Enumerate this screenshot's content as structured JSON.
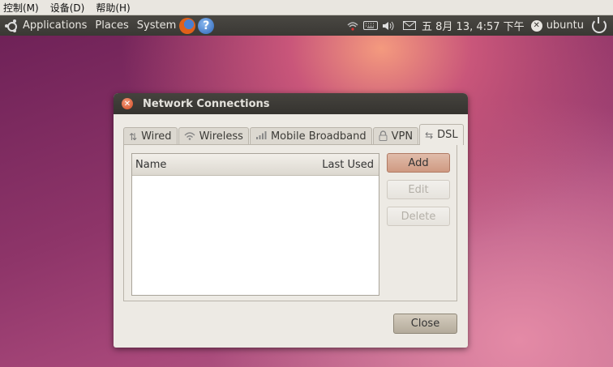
{
  "viewer_menu": [
    "控制(M)",
    "设备(D)",
    "帮助(H)"
  ],
  "panel": {
    "menus": [
      "Applications",
      "Places",
      "System"
    ],
    "clock": "五  8月 13,  4:57 下午",
    "user": "ubuntu"
  },
  "dialog": {
    "title": "Network Connections",
    "tabs": [
      {
        "label": "Wired",
        "icon": "wired-icon"
      },
      {
        "label": "Wireless",
        "icon": "wireless-icon"
      },
      {
        "label": "Mobile Broadband",
        "icon": "mobile-broadband-icon"
      },
      {
        "label": "VPN",
        "icon": "vpn-lock-icon"
      },
      {
        "label": "DSL",
        "icon": "dsl-icon",
        "active": true
      }
    ],
    "columns": {
      "name": "Name",
      "last_used": "Last Used"
    },
    "buttons": {
      "add": "Add",
      "edit": "Edit",
      "delete": "Delete",
      "close": "Close"
    }
  },
  "colors": {
    "accent": "#cf9a82",
    "panel": "#3a3834",
    "dialog_bg": "#edeae4"
  }
}
